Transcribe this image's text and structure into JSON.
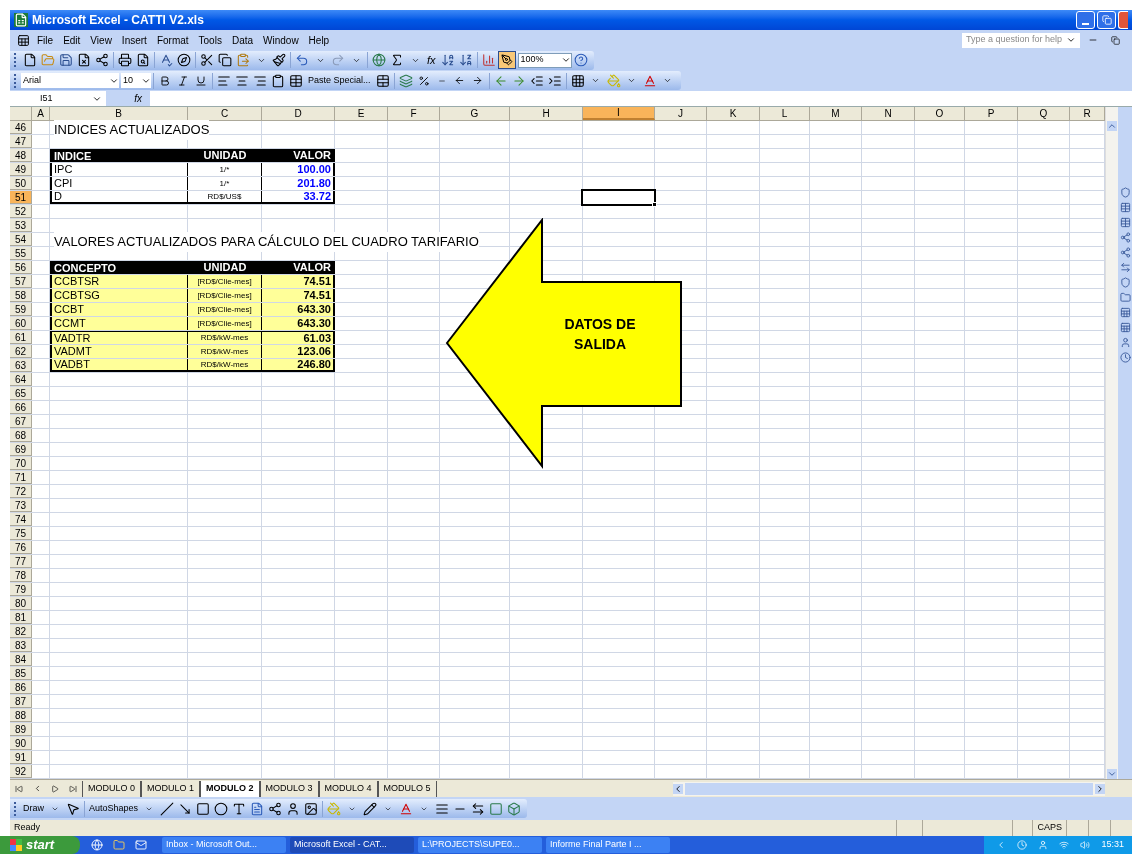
{
  "window": {
    "title": "Microsoft Excel - CATTI V2.xls"
  },
  "menu": [
    "File",
    "Edit",
    "View",
    "Insert",
    "Format",
    "Tools",
    "Data",
    "Window",
    "Help"
  ],
  "help_box": {
    "placeholder": "Type a question for help"
  },
  "standard_toolbar": {
    "function_label": "fx",
    "zoom": "100%"
  },
  "formatting_toolbar": {
    "font": "Arial",
    "size": "10",
    "paste_special": "Paste Special..."
  },
  "formula_bar": {
    "name_box": "I51",
    "function_label": "fx"
  },
  "columns": [
    {
      "label": "A",
      "selected": false
    },
    {
      "label": "B",
      "selected": false
    },
    {
      "label": "C",
      "selected": false
    },
    {
      "label": "D",
      "selected": false
    },
    {
      "label": "E",
      "selected": false
    },
    {
      "label": "F",
      "selected": false
    },
    {
      "label": "G",
      "selected": false
    },
    {
      "label": "H",
      "selected": false
    },
    {
      "label": "I",
      "selected": true
    },
    {
      "label": "J",
      "selected": false
    },
    {
      "label": "K",
      "selected": false
    },
    {
      "label": "L",
      "selected": false
    },
    {
      "label": "M",
      "selected": false
    },
    {
      "label": "N",
      "selected": false
    },
    {
      "label": "O",
      "selected": false
    },
    {
      "label": "P",
      "selected": false
    },
    {
      "label": "Q",
      "selected": false
    },
    {
      "label": "R",
      "selected": false
    }
  ],
  "rows": [
    {
      "label": "46",
      "selected": false,
      "kind": "title",
      "text": "INDICES ACTUALIZADOS"
    },
    {
      "label": "47",
      "selected": false,
      "kind": "empty"
    },
    {
      "label": "48",
      "selected": false,
      "kind": "header",
      "cells": [
        "INDICE",
        "UNIDAD",
        "VALOR"
      ]
    },
    {
      "label": "49",
      "selected": false,
      "kind": "data",
      "cells": [
        "IPC",
        "1/*",
        "100.00"
      ],
      "color": "#0000ff",
      "highlighted": false
    },
    {
      "label": "50",
      "selected": false,
      "kind": "data",
      "cells": [
        "CPI",
        "1/*",
        "201.80"
      ],
      "color": "#0000ff",
      "highlighted": false
    },
    {
      "label": "51",
      "selected": true,
      "kind": "data",
      "cells": [
        "D",
        "RD$/US$",
        "33.72"
      ],
      "color": "#0000ff",
      "highlighted": false
    },
    {
      "label": "52",
      "selected": false,
      "kind": "empty"
    },
    {
      "label": "53",
      "selected": false,
      "kind": "empty"
    },
    {
      "label": "54",
      "selected": false,
      "kind": "title",
      "text": "VALORES ACTUALIZADOS PARA CÁLCULO DEL CUADRO TARIFARIO"
    },
    {
      "label": "55",
      "selected": false,
      "kind": "empty"
    },
    {
      "label": "56",
      "selected": false,
      "kind": "header",
      "cells": [
        "CONCEPTO",
        "UNIDAD",
        "VALOR"
      ]
    },
    {
      "label": "57",
      "selected": false,
      "kind": "data",
      "cells": [
        "CCBTSR",
        "[RD$/Clie-mes]",
        "74.51"
      ],
      "color": "#000000",
      "highlighted": true
    },
    {
      "label": "58",
      "selected": false,
      "kind": "data",
      "cells": [
        "CCBTSG",
        "[RD$/Clie-mes]",
        "74.51"
      ],
      "color": "#000000",
      "highlighted": true
    },
    {
      "label": "59",
      "selected": false,
      "kind": "data",
      "cells": [
        "CCBT",
        "[RD$/Clie-mes]",
        "643.30"
      ],
      "color": "#000000",
      "highlighted": true
    },
    {
      "label": "60",
      "selected": false,
      "kind": "data",
      "cells": [
        "CCMT",
        "[RD$/Clie-mes]",
        "643.30"
      ],
      "color": "#000000",
      "highlighted": true
    },
    {
      "label": "61",
      "selected": false,
      "kind": "data",
      "cells": [
        "VADTR",
        "RD$/kW-mes",
        "61.03"
      ],
      "color": "#000000",
      "highlighted": true,
      "separator_above": true
    },
    {
      "label": "62",
      "selected": false,
      "kind": "data",
      "cells": [
        "VADMT",
        "RD$/kW-mes",
        "123.06"
      ],
      "color": "#000000",
      "highlighted": true
    },
    {
      "label": "63",
      "selected": false,
      "kind": "data",
      "cells": [
        "VADBT",
        "RD$/kW-mes",
        "246.80"
      ],
      "color": "#000000",
      "highlighted": true
    },
    {
      "label": "64",
      "selected": false,
      "kind": "empty"
    },
    {
      "label": "65",
      "selected": false,
      "kind": "empty"
    },
    {
      "label": "66",
      "selected": false,
      "kind": "empty"
    },
    {
      "label": "67",
      "selected": false,
      "kind": "empty"
    },
    {
      "label": "68",
      "selected": false,
      "kind": "empty"
    },
    {
      "label": "69",
      "selected": false,
      "kind": "empty"
    },
    {
      "label": "70",
      "selected": false,
      "kind": "empty"
    },
    {
      "label": "71",
      "selected": false,
      "kind": "empty"
    },
    {
      "label": "72",
      "selected": false,
      "kind": "empty"
    },
    {
      "label": "73",
      "selected": false,
      "kind": "empty"
    },
    {
      "label": "74",
      "selected": false,
      "kind": "empty"
    },
    {
      "label": "75",
      "selected": false,
      "kind": "empty"
    },
    {
      "label": "76",
      "selected": false,
      "kind": "empty"
    },
    {
      "label": "77",
      "selected": false,
      "kind": "empty"
    },
    {
      "label": "78",
      "selected": false,
      "kind": "empty"
    },
    {
      "label": "79",
      "selected": false,
      "kind": "empty"
    },
    {
      "label": "80",
      "selected": false,
      "kind": "empty"
    },
    {
      "label": "81",
      "selected": false,
      "kind": "empty"
    },
    {
      "label": "82",
      "selected": false,
      "kind": "empty"
    },
    {
      "label": "83",
      "selected": false,
      "kind": "empty"
    },
    {
      "label": "84",
      "selected": false,
      "kind": "empty"
    },
    {
      "label": "85",
      "selected": false,
      "kind": "empty"
    },
    {
      "label": "86",
      "selected": false,
      "kind": "empty"
    },
    {
      "label": "87",
      "selected": false,
      "kind": "empty"
    },
    {
      "label": "88",
      "selected": false,
      "kind": "empty"
    },
    {
      "label": "89",
      "selected": false,
      "kind": "empty"
    },
    {
      "label": "90",
      "selected": false,
      "kind": "empty"
    },
    {
      "label": "91",
      "selected": false,
      "kind": "empty"
    },
    {
      "label": "92",
      "selected": false,
      "kind": "empty"
    }
  ],
  "callout": {
    "kind": "left-arrow",
    "lines": [
      "DATOS DE",
      "SALIDA"
    ]
  },
  "sheet_tabs": [
    {
      "label": "MODULO 0",
      "selected": false
    },
    {
      "label": "MODULO 1",
      "selected": false
    },
    {
      "label": "MODULO 2",
      "selected": true
    },
    {
      "label": "MODULO 3",
      "selected": false
    },
    {
      "label": "MODULO 4",
      "selected": false
    },
    {
      "label": "MODULO 5",
      "selected": false
    }
  ],
  "drawing_toolbar": {
    "draw": "Draw",
    "autoshapes": "AutoShapes"
  },
  "status_bar": {
    "status": "Ready",
    "indicators": [
      "CAPS"
    ]
  },
  "taskbar": {
    "start": "start",
    "tasks": [
      {
        "label": "Inbox - Microsoft Out...",
        "selected": false
      },
      {
        "label": "Microsoft Excel - CAT...",
        "selected": true
      },
      {
        "label": "L:\\PROJECTS\\SUPE0...",
        "selected": false
      },
      {
        "label": "Informe Final Parte I ...",
        "selected": false
      }
    ],
    "clock": "15:31"
  }
}
